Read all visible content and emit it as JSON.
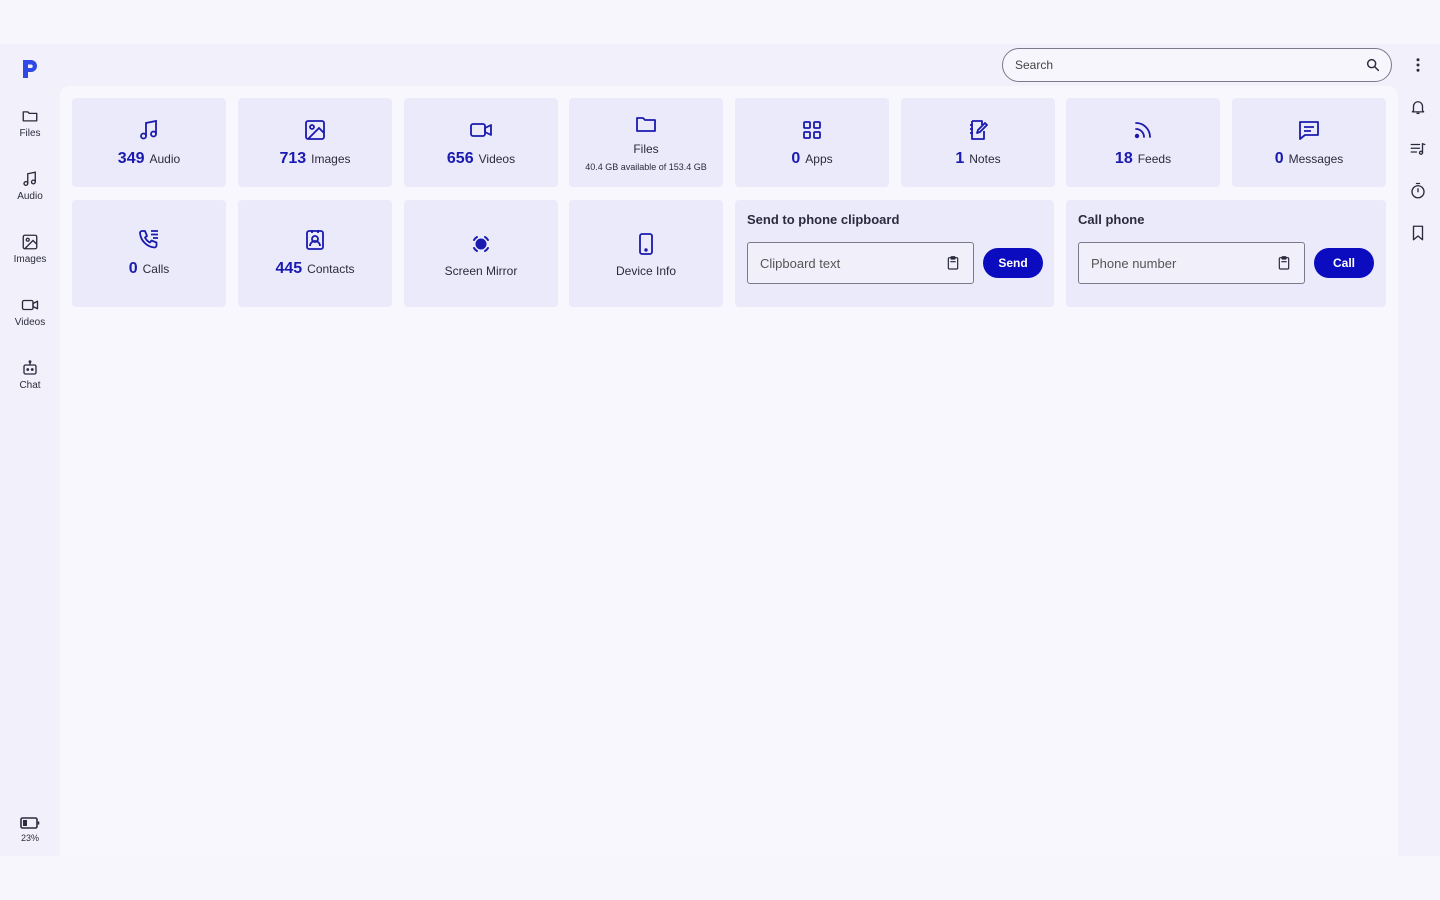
{
  "rail": {
    "items": [
      {
        "label": "Files",
        "icon": "folder-icon"
      },
      {
        "label": "Audio",
        "icon": "music-note-icon"
      },
      {
        "label": "Images",
        "icon": "image-icon"
      },
      {
        "label": "Videos",
        "icon": "video-camera-icon"
      },
      {
        "label": "Chat",
        "icon": "robot-icon"
      }
    ],
    "battery": "23%"
  },
  "search": {
    "placeholder": "Search"
  },
  "tiles": [
    {
      "count": "349",
      "label": "Audio",
      "icon": "music-note-icon"
    },
    {
      "count": "713",
      "label": "Images",
      "icon": "image-icon"
    },
    {
      "count": "656",
      "label": "Videos",
      "icon": "video-camera-icon"
    },
    {
      "label": "Files",
      "sub": "40.4 GB available of 153.4 GB",
      "icon": "folder-icon"
    },
    {
      "count": "0",
      "label": "Apps",
      "icon": "apps-grid-icon"
    },
    {
      "count": "1",
      "label": "Notes",
      "icon": "notebook-icon"
    },
    {
      "count": "18",
      "label": "Feeds",
      "icon": "rss-icon"
    },
    {
      "count": "0",
      "label": "Messages",
      "icon": "message-icon"
    },
    {
      "count": "0",
      "label": "Calls",
      "icon": "phone-list-icon"
    },
    {
      "count": "445",
      "label": "Contacts",
      "icon": "contact-card-icon"
    },
    {
      "label": "Screen Mirror",
      "icon": "screen-mirror-icon"
    },
    {
      "label": "Device Info",
      "icon": "phone-device-icon"
    }
  ],
  "clipboard": {
    "title": "Send to phone clipboard",
    "placeholder": "Clipboard text",
    "button": "Send"
  },
  "call": {
    "title": "Call phone",
    "placeholder": "Phone number",
    "button": "Call"
  },
  "colors": {
    "accent": "#0b0bbf",
    "tile": "#ebeafa",
    "background": "#f7f6fd"
  }
}
